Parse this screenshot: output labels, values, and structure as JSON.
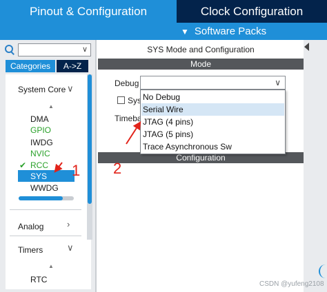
{
  "tabs": {
    "pinout": "Pinout & Configuration",
    "clock": "Clock Configuration",
    "software_packs": "Software Packs"
  },
  "left_panel": {
    "search_value": "",
    "categories_tab": "Categories",
    "az_tab": "A->Z",
    "system_core": {
      "label": "System Core",
      "items": [
        "DMA",
        "GPIO",
        "IWDG",
        "NVIC",
        "RCC",
        "SYS",
        "WWDG"
      ],
      "green_items": [
        "GPIO",
        "NVIC",
        "RCC"
      ],
      "selected": "SYS"
    },
    "analog": "Analog",
    "timers": {
      "label": "Timers",
      "items": [
        "RTC"
      ]
    }
  },
  "main": {
    "mode_title": "SYS Mode and Configuration",
    "mode_header": "Mode",
    "debug_label": "Debug",
    "debug_value": "",
    "sys_label_partial": "Sys",
    "timebase_partial": "Timeba",
    "dropdown_options": [
      "No Debug",
      "Serial Wire",
      "JTAG (4 pins)",
      "JTAG (5 pins)",
      "Trace Asynchronous Sw"
    ],
    "highlighted_option": "Serial Wire",
    "configuration_header": "Configuration"
  },
  "annotations": {
    "step_1": "1",
    "step_2": "2",
    "arrow_color": "#e2231a"
  },
  "watermark": "CSDN @yufeng2108",
  "colors": {
    "accent": "#1f8fd8",
    "dark_navy": "#03234b",
    "header_gray": "#54575b",
    "enabled_green": "#2aa12a",
    "highlight": "#d5e6f5"
  }
}
